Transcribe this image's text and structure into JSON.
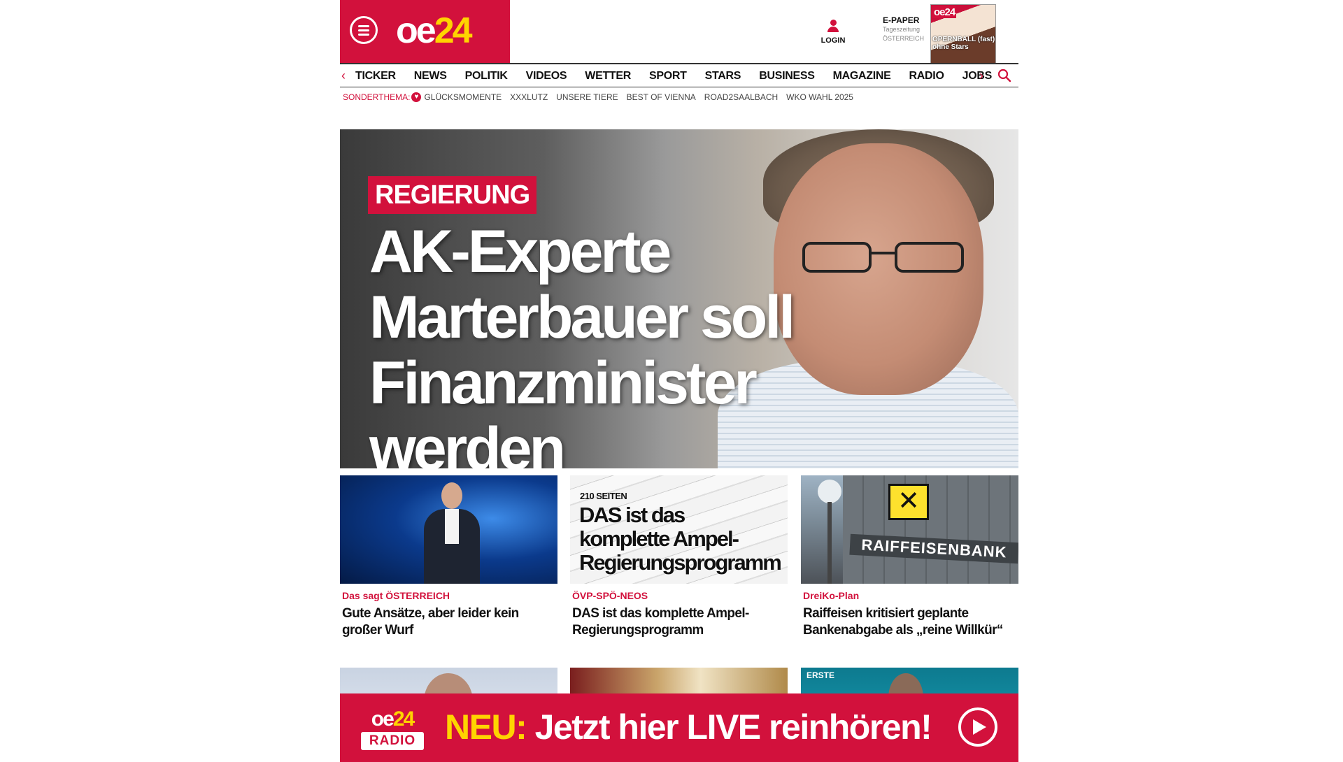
{
  "brand": {
    "logo_main": "oe",
    "logo_num": "24",
    "accent_color": "#d2113c",
    "logo_num_color": "#ffd400"
  },
  "header": {
    "menu_icon": "hamburger-menu-icon",
    "login_label": "LOGIN",
    "epaper_title": "E-PAPER",
    "epaper_subtitle": "Tageszeitung",
    "epaper_region": "ÖSTERREICH",
    "epaper_cover_logo": "oe24",
    "epaper_cover_headline": "OPERNBALL (fast) ohne Stars"
  },
  "nav": {
    "items": [
      "TICKER",
      "NEWS",
      "POLITIK",
      "VIDEOS",
      "WETTER",
      "SPORT",
      "STARS",
      "BUSINESS",
      "MAGAZINE",
      "RADIO",
      "JOBS"
    ],
    "left_arrow": "‹",
    "right_arrow": "›"
  },
  "subnav": {
    "lead": "SONDERTHEMA:",
    "items": [
      "GLÜCKSMOMENTE",
      "XXXLUTZ",
      "UNSERE TIERE",
      "BEST OF VIENNA",
      "ROAD2SAALBACH",
      "WKO WAHL 2025"
    ]
  },
  "hero": {
    "kicker": "REGIERUNG",
    "title_line1": "AK-Experte",
    "title_line2": "Marterbauer soll",
    "title_line3": "Finanzminister werden"
  },
  "cards": [
    {
      "kicker": "Das sagt ÖSTERREICH",
      "title": "Gute Ansätze, aber leider kein großer Wurf"
    },
    {
      "kicker": "ÖVP-SPÖ-NEOS",
      "title": "DAS ist das komplette Ampel-Regierungsprogramm",
      "img_small": "210 SEITEN",
      "img_big_line1": "DAS ist das",
      "img_big_line2": "komplette Ampel-",
      "img_big_line3": "Regierungsprogramm"
    },
    {
      "kicker": "DreiKo-Plan",
      "title": "Raiffeisen kritisiert geplante Bankenabgabe als „reine Willkür“",
      "img_sign": "RAIFFEISENBANK"
    }
  ],
  "second_row": {
    "thumb3_brand": "ERSTE"
  },
  "radio_banner": {
    "logo_oe": "oe",
    "logo_num": "24",
    "logo_radio": "RADIO",
    "neu": "NEU:",
    "message": "Jetzt hier LIVE reinhören!"
  }
}
